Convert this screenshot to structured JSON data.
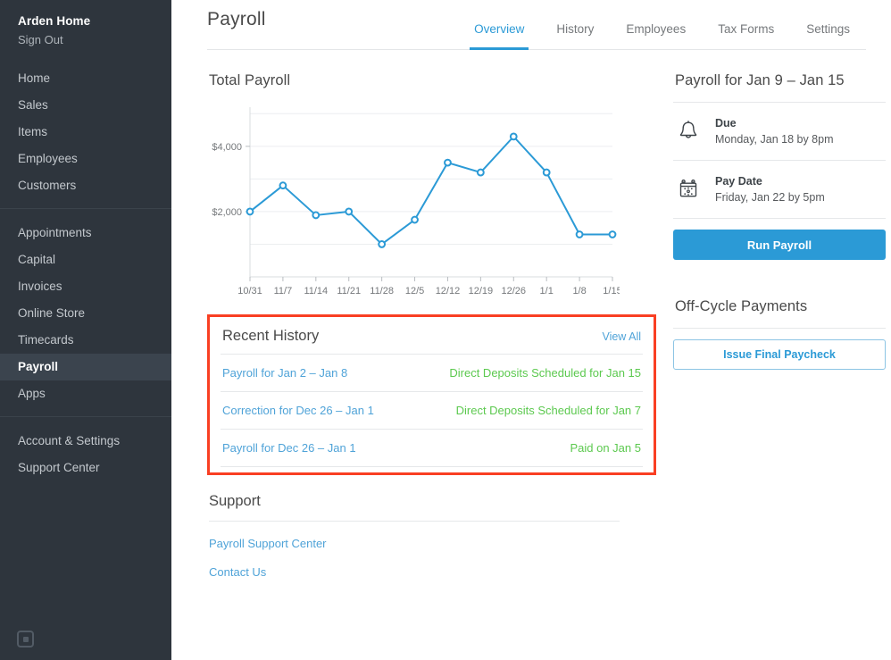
{
  "sidebar": {
    "brand": "Arden Home",
    "sign_out": "Sign Out",
    "group1": [
      {
        "label": "Home"
      },
      {
        "label": "Sales"
      },
      {
        "label": "Items"
      },
      {
        "label": "Employees"
      },
      {
        "label": "Customers"
      }
    ],
    "group2": [
      {
        "label": "Appointments"
      },
      {
        "label": "Capital"
      },
      {
        "label": "Invoices"
      },
      {
        "label": "Online Store"
      },
      {
        "label": "Timecards"
      },
      {
        "label": "Payroll"
      },
      {
        "label": "Apps"
      }
    ],
    "group3": [
      {
        "label": "Account & Settings"
      },
      {
        "label": "Support Center"
      }
    ],
    "active_item": "Payroll",
    "logo_icon": "square-logo-icon"
  },
  "header": {
    "title": "Payroll",
    "tabs": [
      {
        "label": "Overview",
        "active": true
      },
      {
        "label": "History",
        "active": false
      },
      {
        "label": "Employees",
        "active": false
      },
      {
        "label": "Tax Forms",
        "active": false
      },
      {
        "label": "Settings",
        "active": false
      }
    ]
  },
  "chart_data": {
    "type": "line",
    "title": "Total Payroll",
    "xlabel": "",
    "ylabel": "",
    "categories": [
      "10/31",
      "11/7",
      "11/14",
      "11/21",
      "11/28",
      "12/5",
      "12/12",
      "12/19",
      "12/26",
      "1/1",
      "1/8",
      "1/15"
    ],
    "values": [
      2000,
      2800,
      1890,
      2000,
      1000,
      1750,
      3500,
      3200,
      4300,
      3200,
      1300,
      1300
    ],
    "ytick_labels": [
      "$2,000",
      "$4,000"
    ],
    "ytick_values": [
      2000,
      4000
    ],
    "gridlines": [
      1000,
      2000,
      3000,
      4000,
      5000
    ],
    "ylim": [
      0,
      5200
    ],
    "grid": true,
    "legend": "none",
    "series_color": "#2b9ad6"
  },
  "recent_history": {
    "title": "Recent History",
    "view_all": "View All",
    "highlight_color": "#f93f23",
    "rows": [
      {
        "name": "Payroll for Jan 2 – Jan 8",
        "status": "Direct Deposits Scheduled for Jan 15"
      },
      {
        "name": "Correction for Dec 26 – Jan 1",
        "status": "Direct Deposits Scheduled for Jan 7"
      },
      {
        "name": "Payroll for Dec 26 – Jan 1",
        "status": "Paid on Jan 5"
      }
    ]
  },
  "support": {
    "title": "Support",
    "links": [
      {
        "label": "Payroll Support Center"
      },
      {
        "label": "Contact Us"
      }
    ]
  },
  "rail": {
    "title": "Payroll for Jan 9 – Jan 15",
    "due": {
      "icon": "bell-icon",
      "label": "Due",
      "value": "Monday, Jan 18 by 8pm"
    },
    "pay_date": {
      "icon": "calendar-icon",
      "label": "Pay Date",
      "value": "Friday, Jan 22 by 5pm"
    },
    "run_payroll_label": "Run Payroll",
    "off_cycle_title": "Off-Cycle Payments",
    "issue_final_paycheck_label": "Issue Final Paycheck"
  }
}
